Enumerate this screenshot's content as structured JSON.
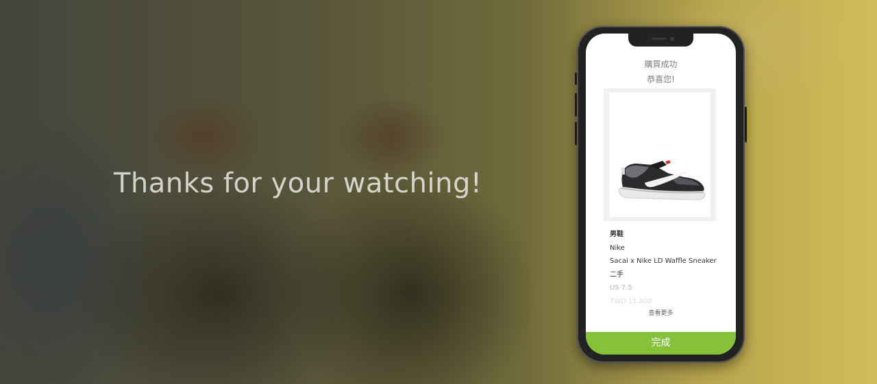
{
  "headline": "Thanks for your watching!",
  "screen": {
    "title": "購買成功",
    "subtitle": "恭喜您!",
    "product": {
      "image_icon": "sneaker-icon",
      "category": "男鞋",
      "brand": "Nike",
      "name": "Sacai x Nike LD Waffle Sneaker",
      "condition": "二手",
      "size": "US 7.5",
      "price": "TWD 11,800"
    },
    "see_more": "查看更多",
    "done_button": "完成"
  },
  "colors": {
    "accent": "#86c13a",
    "title_text": "#7d7d7d"
  }
}
